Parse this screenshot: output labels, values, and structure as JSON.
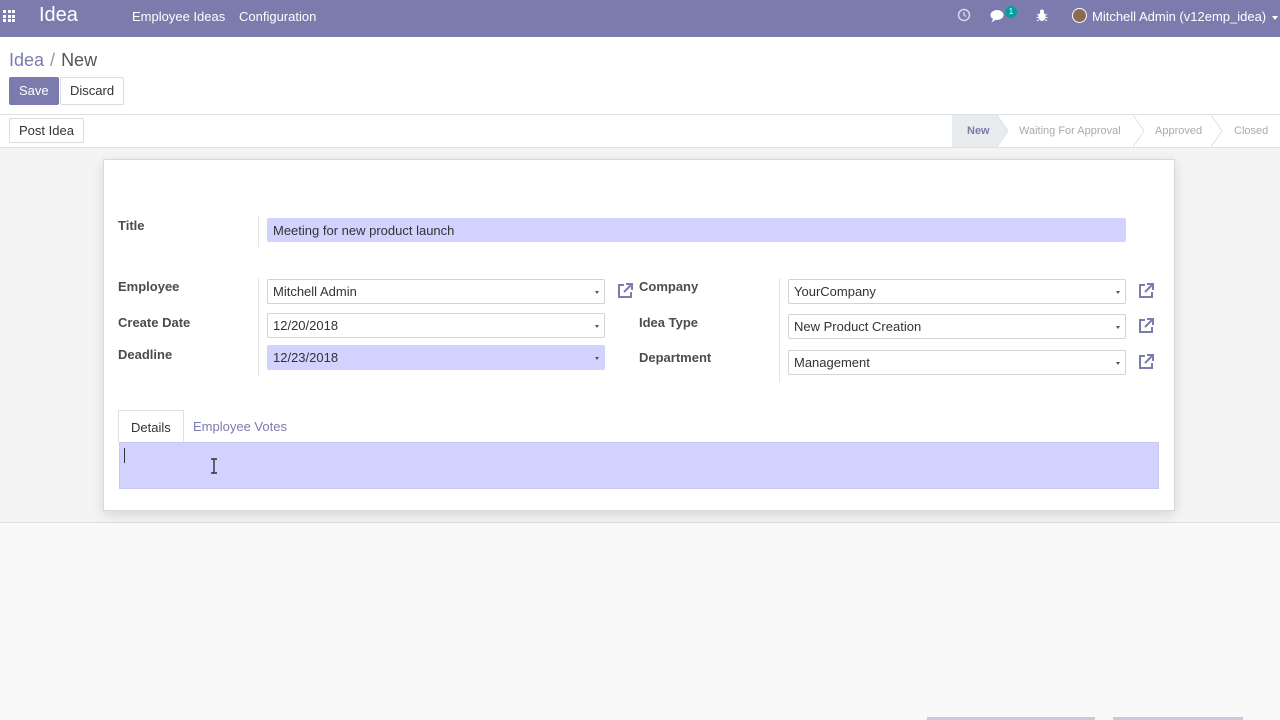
{
  "navbar": {
    "app_title": "Idea",
    "menu": [
      "Employee Ideas",
      "Configuration"
    ],
    "chat_badge": "1",
    "user": "Mitchell Admin (v12emp_idea)",
    "icons": [
      "apps-icon",
      "clock-icon",
      "chat-icon",
      "bug-icon"
    ]
  },
  "breadcrumb": {
    "parent": "Idea",
    "separator": "/",
    "current": "New"
  },
  "buttons": {
    "save": "Save",
    "discard": "Discard",
    "post_idea": "Post Idea"
  },
  "stages": [
    {
      "label": "New",
      "active": true
    },
    {
      "label": "Waiting For Approval",
      "active": false
    },
    {
      "label": "Approved",
      "active": false
    },
    {
      "label": "Closed",
      "active": false
    }
  ],
  "form": {
    "title_label": "Title",
    "title_value": "Meeting for new product launch",
    "employee_label": "Employee",
    "employee_value": "Mitchell Admin",
    "create_date_label": "Create Date",
    "create_date_value": "12/20/2018",
    "deadline_label": "Deadline",
    "deadline_value": "12/23/2018",
    "company_label": "Company",
    "company_value": "YourCompany",
    "idea_type_label": "Idea Type",
    "idea_type_value": "New Product Creation",
    "department_label": "Department",
    "department_value": "Management"
  },
  "tabs": {
    "details": "Details",
    "votes": "Employee Votes"
  },
  "colors": {
    "brand": "#7c7bad",
    "required_field": "#d2d2ff"
  }
}
